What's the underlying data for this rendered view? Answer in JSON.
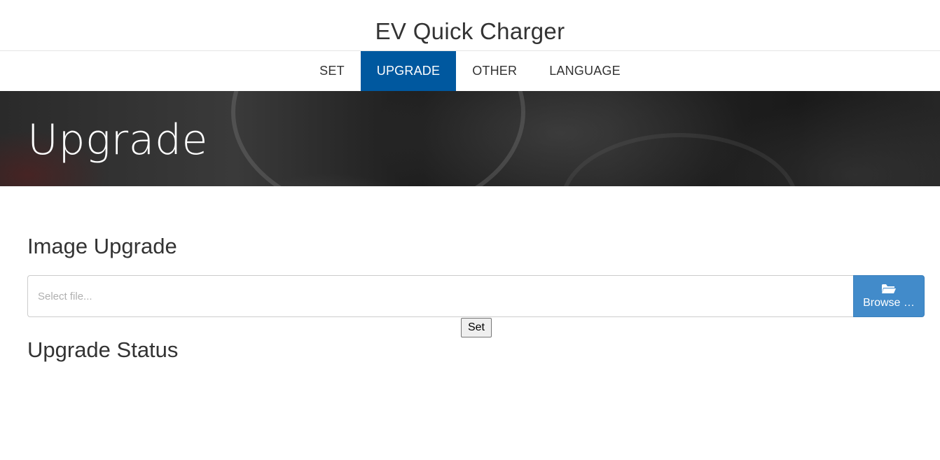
{
  "header": {
    "title": "EV Quick Charger"
  },
  "nav": {
    "items": [
      {
        "label": "SET",
        "active": false
      },
      {
        "label": "UPGRADE",
        "active": true
      },
      {
        "label": "OTHER",
        "active": false
      },
      {
        "label": "LANGUAGE",
        "active": false
      }
    ]
  },
  "hero": {
    "title": "Upgrade"
  },
  "image_upgrade": {
    "title": "Image Upgrade",
    "file_placeholder": "Select file...",
    "file_value": "",
    "browse_label": "Browse …",
    "browse_icon": "folder-open-icon",
    "set_label": "Set"
  },
  "upgrade_status": {
    "title": "Upgrade Status"
  },
  "colors": {
    "nav_active_bg": "#00589f",
    "browse_bg": "#428bca",
    "text": "#333333"
  }
}
